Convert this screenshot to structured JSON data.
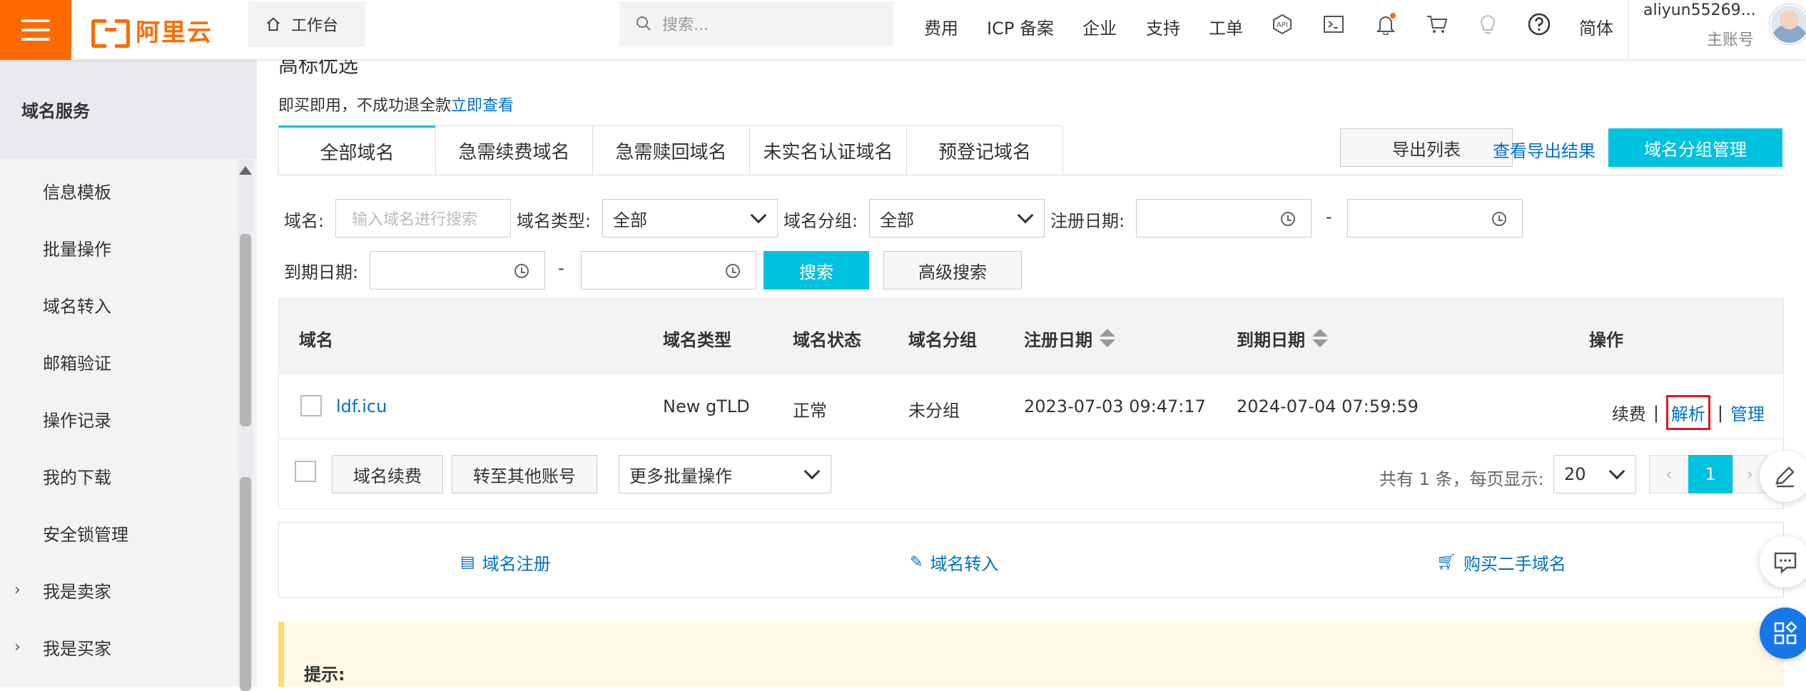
{
  "topbar": {
    "logo_text": "阿里云",
    "workbench": "工作台",
    "search_placeholder": "搜索...",
    "nav": [
      "费用",
      "ICP 备案",
      "企业",
      "支持",
      "工单"
    ],
    "lang": "简体",
    "user_name": "aliyun55269...",
    "user_role": "主账号",
    "icons": [
      "api-icon",
      "terminal-icon",
      "bell-icon",
      "cart-icon",
      "lightbulb-icon",
      "help-icon"
    ]
  },
  "sidebar": {
    "header": "域名服务",
    "items": [
      "信息模板",
      "批量操作",
      "域名转入",
      "邮箱验证",
      "操作记录",
      "我的下载",
      "安全锁管理"
    ],
    "expandable": [
      "我是卖家",
      "我是买家"
    ]
  },
  "main": {
    "partial_title": "高标优选",
    "tip_text": "即买即用，不成功退全款",
    "tip_link": "立即查看",
    "tabs": [
      "全部域名",
      "急需续费域名",
      "急需赎回域名",
      "未实名认证域名",
      "预登记域名"
    ],
    "active_tab": 0,
    "actions": {
      "export": "导出列表",
      "view_export": "查看导出结果",
      "group_manage": "域名分组管理"
    },
    "filters": {
      "domain_label": "域名:",
      "domain_placeholder": "输入域名进行搜索",
      "type_label": "域名类型:",
      "type_value": "全部",
      "group_label": "域名分组:",
      "group_value": "全部",
      "reg_label": "注册日期:",
      "exp_label": "到期日期:",
      "range_sep": "-",
      "search_btn": "搜索",
      "advanced_btn": "高级搜索"
    },
    "table": {
      "columns": [
        "域名",
        "域名类型",
        "域名状态",
        "域名分组",
        "注册日期",
        "到期日期",
        "操作"
      ],
      "rows": [
        {
          "domain": "ldf.icu",
          "type": "New gTLD",
          "status": "正常",
          "group": "未分组",
          "reg_date": "2023-07-03 09:47:17",
          "exp_date": "2024-07-04 07:59:59",
          "ops": [
            "续费",
            "解析",
            "管理"
          ],
          "op_sep": "|"
        }
      ],
      "footer": {
        "renew_btn": "域名续费",
        "transfer_btn": "转至其他账号",
        "more_ops": "更多批量操作",
        "total_text": "共有 1 条，每页显示:",
        "page_size": "20",
        "prev": "‹",
        "current_page": "1",
        "next": "›"
      }
    },
    "quick_links": [
      "域名注册",
      "域名转入",
      "购买二手域名"
    ],
    "notice_title": "提示:"
  },
  "colors": {
    "brand_orange": "#ff6a00",
    "accent_cyan": "#00c1de",
    "link_blue": "#0070cc",
    "highlight_red": "#e0191f"
  }
}
